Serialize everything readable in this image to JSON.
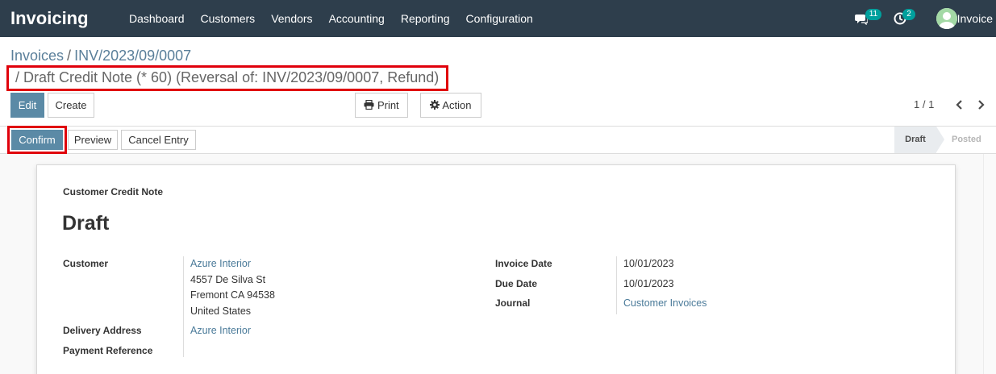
{
  "navbar": {
    "brand": "Invoicing",
    "menu": [
      "Dashboard",
      "Customers",
      "Vendors",
      "Accounting",
      "Reporting",
      "Configuration"
    ],
    "messages_count": "11",
    "activities_count": "2",
    "user_name": "Invoice"
  },
  "breadcrumb": {
    "root": "Invoices",
    "sep": "/",
    "parent": "INV/2023/09/0007",
    "current": "/ Draft Credit Note (* 60) (Reversal of: INV/2023/09/0007, Refund)"
  },
  "toolbar": {
    "edit": "Edit",
    "create": "Create",
    "print": "Print",
    "action": "Action",
    "pager": "1 / 1"
  },
  "statusbar": {
    "confirm": "Confirm",
    "preview": "Preview",
    "cancel_entry": "Cancel Entry",
    "stages": [
      "Draft",
      "Posted"
    ],
    "active_stage": "Draft"
  },
  "sheet": {
    "doc_type": "Customer Credit Note",
    "title": "Draft",
    "labels": {
      "customer": "Customer",
      "delivery_address": "Delivery Address",
      "payment_reference": "Payment Reference",
      "invoice_date": "Invoice Date",
      "due_date": "Due Date",
      "journal": "Journal"
    },
    "values": {
      "customer_name": "Azure Interior",
      "address_line1": "4557 De Silva St",
      "address_line2": "Fremont CA 94538",
      "address_line3": "United States",
      "delivery_address": "Azure Interior",
      "invoice_date": "10/01/2023",
      "due_date": "10/01/2023",
      "journal": "Customer Invoices"
    }
  },
  "colors": {
    "navbar": "#2e3e4c",
    "primary": "#5b8aa6",
    "badge": "#00a09d",
    "highlight": "#e0000b",
    "link": "#4a7a99"
  }
}
